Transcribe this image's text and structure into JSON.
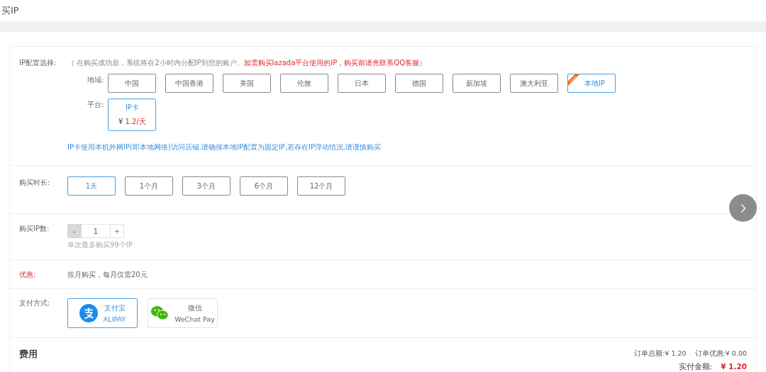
{
  "page_title": "买IP",
  "config": {
    "label": "IP配置选择:",
    "note_plain": "（ 在购买成功后，系统将在2小时内分配IP到您的账户。",
    "note_alert": "如需购买lazada平台使用的IP，购买前请先联系QQ客服",
    "note_end": "）",
    "region_label": "地域:",
    "regions": [
      {
        "label": "中国",
        "selected": false,
        "badge": false
      },
      {
        "label": "中国香港",
        "selected": false,
        "badge": false
      },
      {
        "label": "美国",
        "selected": false,
        "badge": false
      },
      {
        "label": "伦敦",
        "selected": false,
        "badge": false
      },
      {
        "label": "日本",
        "selected": false,
        "badge": false
      },
      {
        "label": "德国",
        "selected": false,
        "badge": false
      },
      {
        "label": "新加坡",
        "selected": false,
        "badge": false
      },
      {
        "label": "澳大利亚",
        "selected": false,
        "badge": false
      },
      {
        "label": "本地IP",
        "selected": true,
        "badge": true
      }
    ],
    "platform_label": "平台:",
    "platforms": [
      {
        "name": "IP卡",
        "currency": "¥",
        "price": "1.2/天",
        "selected": true
      }
    ],
    "hint": "IP卡使用本机外网IP(即本地网络)访问店铺,请确保本地IP配置为固定IP,若存在IP浮动情况,请谨慎购买"
  },
  "duration": {
    "label": "购买时长:",
    "options": [
      {
        "label": "1天",
        "selected": true
      },
      {
        "label": "1个月",
        "selected": false
      },
      {
        "label": "3个月",
        "selected": false
      },
      {
        "label": "6个月",
        "selected": false
      },
      {
        "label": "12个月",
        "selected": false
      }
    ]
  },
  "quantity": {
    "label": "购买IP数:",
    "minus": "-",
    "value": "1",
    "plus": "+",
    "minus_disabled": true,
    "hint": "单次最多购买99个IP"
  },
  "discount": {
    "label": "优惠:",
    "text": "按月购买，每月仅需20元"
  },
  "payment": {
    "label": "支付方式:",
    "methods": [
      {
        "kind": "alipay",
        "name": "支付宝",
        "sub": "ALIPAY",
        "selected": true
      },
      {
        "kind": "wechat",
        "name": "微信",
        "sub": "WeChat Pay",
        "selected": false
      }
    ]
  },
  "fee": {
    "title": "费用",
    "total": "订单总额:¥ 1.20",
    "discount": "订单优惠:¥ 0.00",
    "paid_label": "实付金额:",
    "paid": "¥ 1.20"
  }
}
